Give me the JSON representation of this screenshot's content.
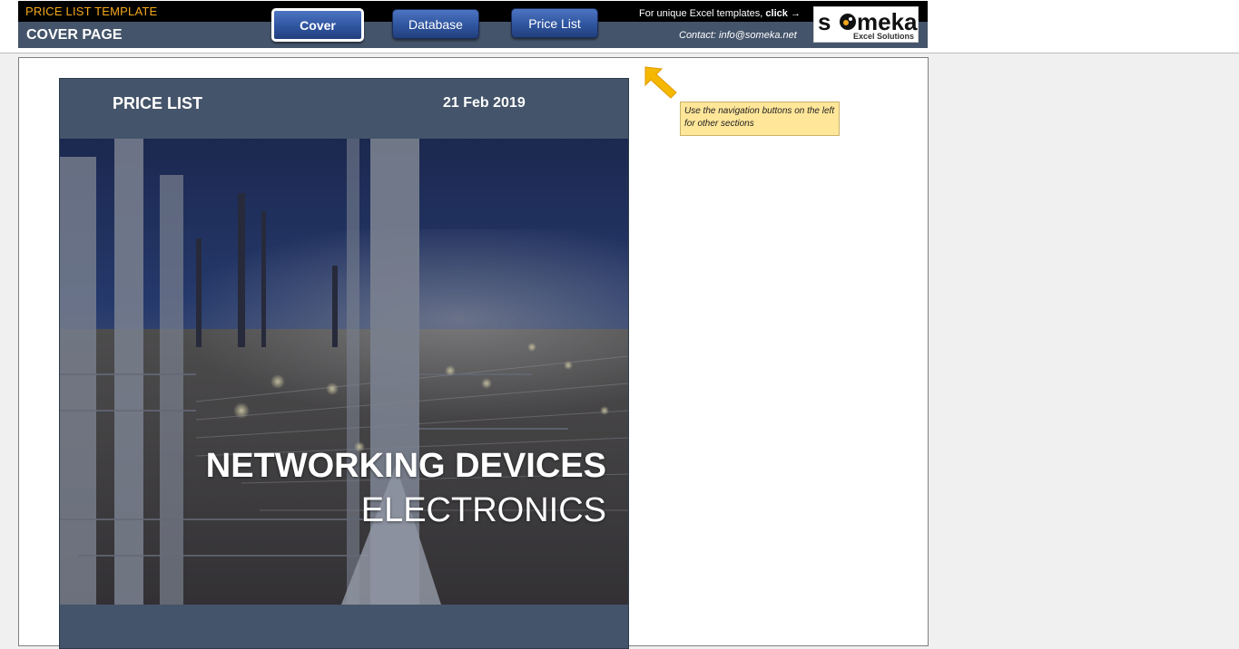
{
  "header": {
    "app_title": "PRICE LIST TEMPLATE",
    "page_title": "COVER PAGE",
    "promo_text": "For unique Excel templates,",
    "promo_link": "click",
    "promo_arrow": "→",
    "contact": "Contact: info@someka.net"
  },
  "nav": {
    "cover": "Cover",
    "database": "Database",
    "price_list": "Price List",
    "active": "Cover"
  },
  "logo": {
    "wordmark": "someka",
    "tagline": "Excel Solutions"
  },
  "cover": {
    "label": "PRICE LIST",
    "date": "21 Feb 2019",
    "headline": "NETWORKING DEVICES",
    "subheadline": "ELECTRONICS",
    "image": "industrial-plant-night-photo"
  },
  "note": {
    "text": "Use the navigation buttons on the left for other sections",
    "arrow_icon": "arrow-up-left-icon"
  },
  "colors": {
    "header_bg": "#44546a",
    "header_top": "#000000",
    "accent_orange": "#f4a81d",
    "button_blue": "#2f559f",
    "note_bg": "#ffe699",
    "arrow": "#f5b800"
  }
}
